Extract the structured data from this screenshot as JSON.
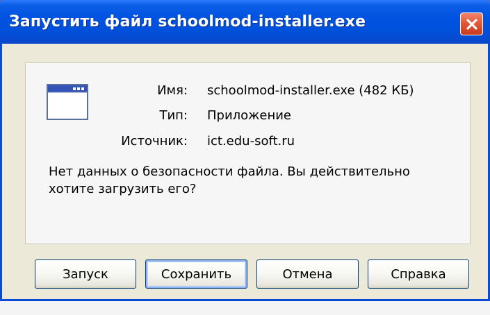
{
  "window": {
    "title": "Запустить файл schoolmod-installer.exe",
    "close_icon": "close-icon"
  },
  "file_info": {
    "icon": "application-window-icon",
    "name_label": "Имя:",
    "name_value": "schoolmod-installer.exe (482 КБ)",
    "type_label": "Тип:",
    "type_value": "Приложение",
    "source_label": "Источник:",
    "source_value": "ict.edu-soft.ru"
  },
  "warning": {
    "line1": "Нет данных о безопасности файла. Вы действительно",
    "line2": "хотите загрузить его?"
  },
  "buttons": {
    "run": "Запуск",
    "save": "Сохранить",
    "cancel": "Отмена",
    "help": "Справка"
  },
  "colors": {
    "titlebar": "#0053e0",
    "close_button": "#e05a3a",
    "window_bg": "#ece9d8",
    "panel_bg": "#f6f6f6"
  }
}
